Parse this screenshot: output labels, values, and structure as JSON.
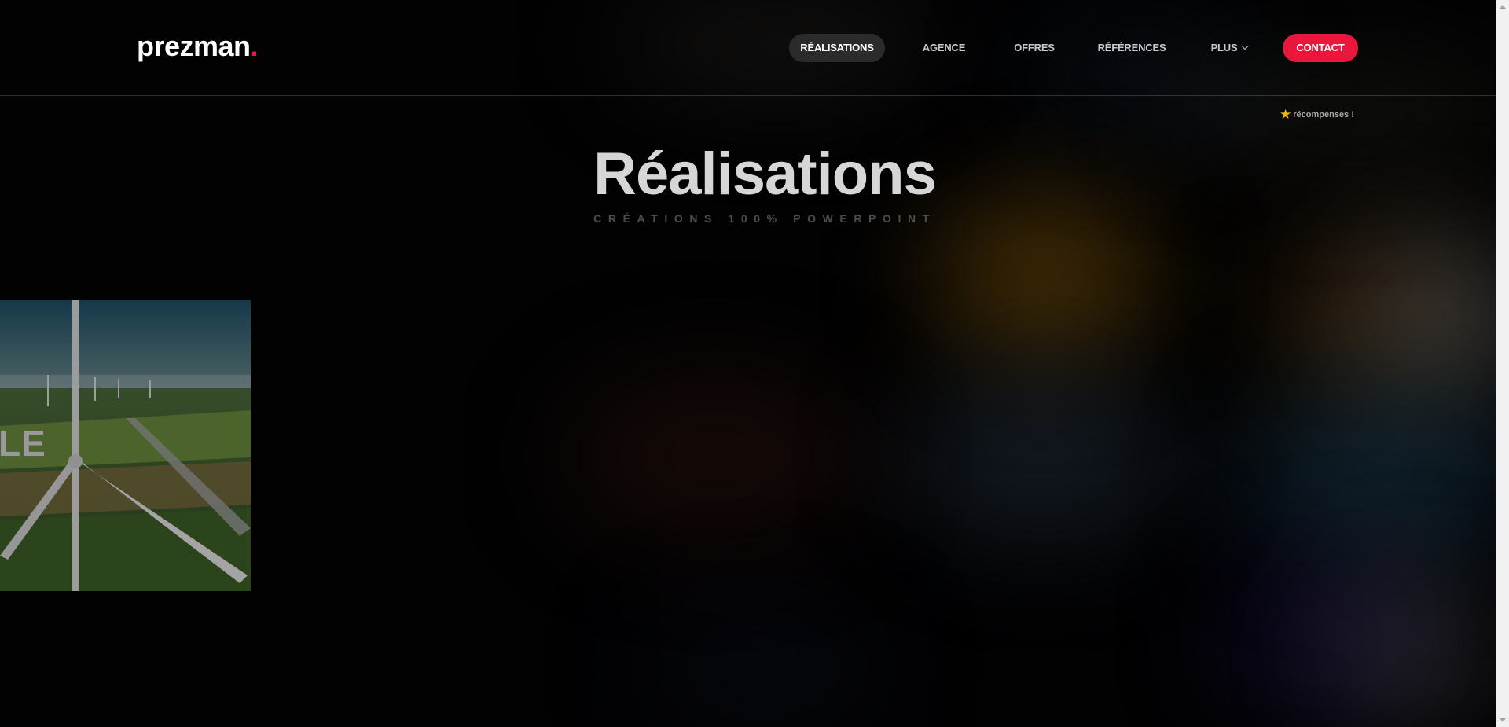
{
  "header": {
    "logo_text": "prezman",
    "logo_dot": ".",
    "nav": {
      "realisations": "RÉALISATIONS",
      "agence": "AGENCE",
      "offres": "OFFRES",
      "references": "RÉFÉRENCES",
      "plus": "PLUS"
    },
    "contact_label": "CONTACT"
  },
  "awards": {
    "label": "récompenses !",
    "icon": "star-icon"
  },
  "hero": {
    "title": "Réalisations",
    "subtitle": "CRÉATIONS 100% POWERPOINT"
  },
  "project_card": {
    "visible_text": "LE"
  },
  "colors": {
    "accent": "#e8173b",
    "background": "#020203",
    "nav_active_bg": "#2b2b2b",
    "star": "#f2b705"
  }
}
